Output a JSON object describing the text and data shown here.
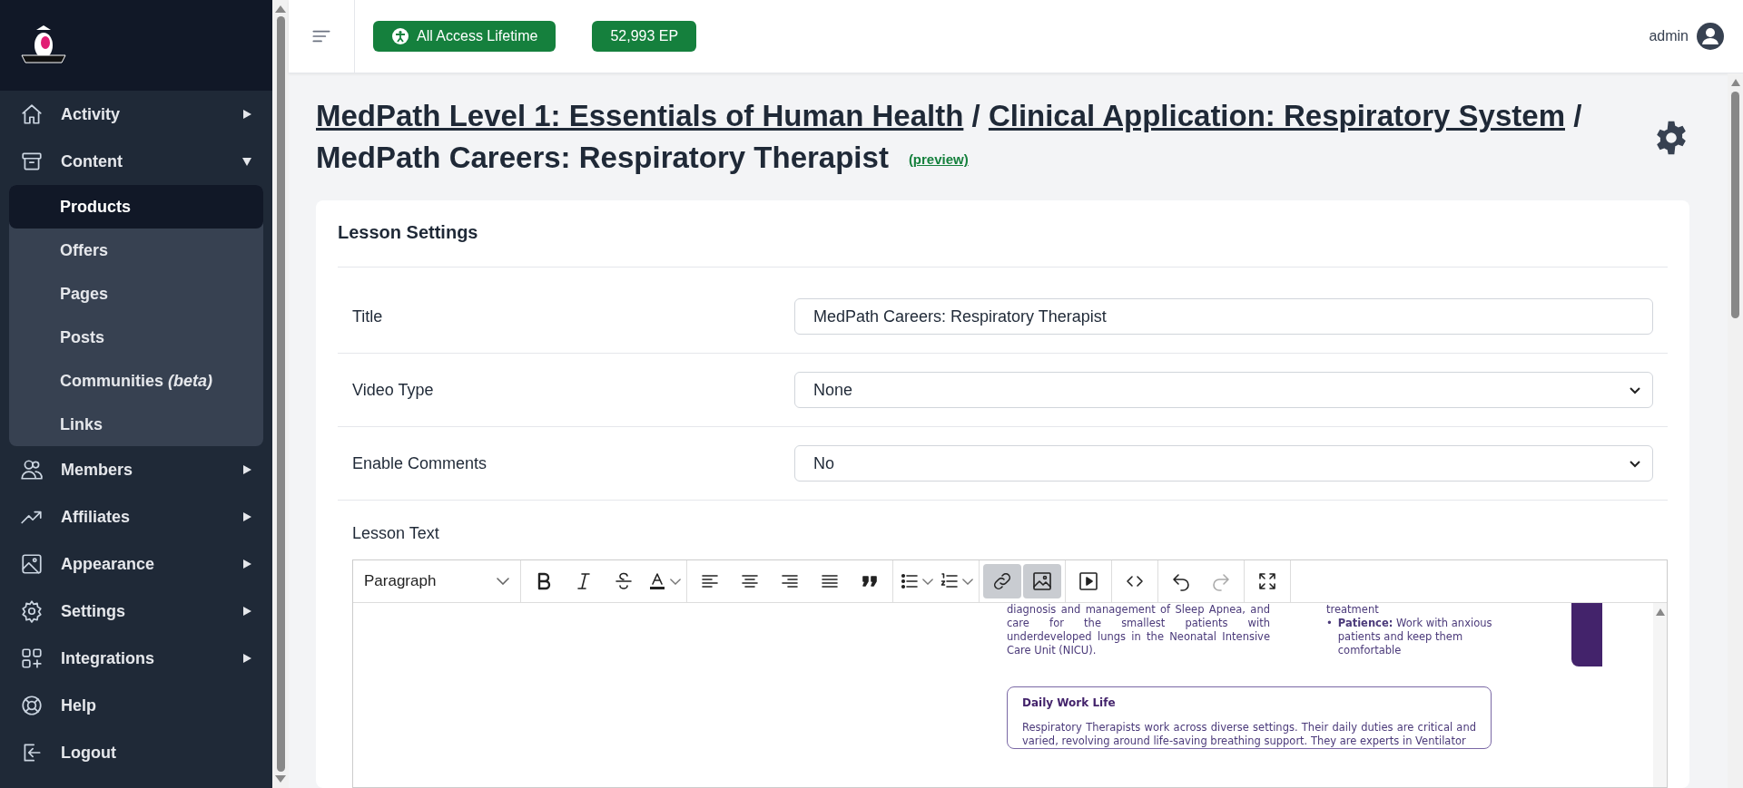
{
  "sidebar": {
    "items": [
      {
        "label": "Activity",
        "kind": "group",
        "expanded": false
      },
      {
        "label": "Content",
        "kind": "group",
        "expanded": true,
        "children": [
          {
            "label": "Products",
            "selected": true
          },
          {
            "label": "Offers",
            "selected": false
          },
          {
            "label": "Pages",
            "selected": false
          },
          {
            "label": "Posts",
            "selected": false
          },
          {
            "label": "Communities *(beta)*",
            "selected": false
          },
          {
            "label": "Links",
            "selected": false
          }
        ]
      },
      {
        "label": "Members",
        "kind": "group",
        "expanded": false
      },
      {
        "label": "Affiliates",
        "kind": "group",
        "expanded": false
      },
      {
        "label": "Appearance",
        "kind": "group",
        "expanded": false
      },
      {
        "label": "Settings",
        "kind": "group",
        "expanded": false
      },
      {
        "label": "Integrations",
        "kind": "group",
        "expanded": false
      },
      {
        "label": "Help",
        "kind": "link"
      },
      {
        "label": "Logout",
        "kind": "link"
      }
    ]
  },
  "top_bar": {
    "plan_badge": "All Access Lifetime",
    "points_badge": "52,993 EP",
    "user": "admin"
  },
  "header": {
    "breadcrumbs": [
      {
        "label": "MedPath Level 1: Essentials of Human Health",
        "kind": "link"
      },
      {
        "label": "Clinical Application: Respiratory System",
        "kind": "link"
      },
      {
        "label": "MedPath Careers: Respiratory Therapist",
        "kind": "current"
      }
    ],
    "separator": "/",
    "preview_link": "(preview)"
  },
  "lesson_settings": {
    "title": "Lesson Settings",
    "fields": [
      {
        "label": "Title",
        "kind": "text",
        "value": "MedPath Careers: Respiratory Therapist"
      },
      {
        "label": "Video Type",
        "kind": "select",
        "value": "None"
      },
      {
        "label": "Enable Comments",
        "kind": "select",
        "value": "No"
      }
    ],
    "lesson_text_label": "Lesson Text"
  },
  "editor": {
    "format_select": "Paragraph",
    "toolbar_groups": [
      [
        {
          "kind": "button",
          "active": false,
          "disabled": false
        },
        {
          "kind": "button",
          "active": false,
          "disabled": false
        },
        {
          "kind": "button",
          "active": false,
          "disabled": false
        },
        {
          "kind": "split",
          "active": false,
          "disabled": false
        }
      ],
      [
        {
          "kind": "button",
          "active": false,
          "disabled": false
        },
        {
          "kind": "button",
          "active": false,
          "disabled": false
        },
        {
          "kind": "button",
          "active": false,
          "disabled": false
        },
        {
          "kind": "button",
          "active": false,
          "disabled": false
        },
        {
          "kind": "button",
          "active": false,
          "disabled": false
        }
      ],
      [
        {
          "kind": "split",
          "active": false,
          "disabled": false
        },
        {
          "kind": "split",
          "active": false,
          "disabled": false
        }
      ],
      [
        {
          "kind": "button",
          "active": true,
          "disabled": false
        },
        {
          "kind": "button",
          "active": true,
          "disabled": false
        }
      ],
      [
        {
          "kind": "button",
          "active": false,
          "disabled": false
        }
      ],
      [
        {
          "kind": "button",
          "active": false,
          "disabled": false
        }
      ],
      [
        {
          "kind": "button",
          "active": false,
          "disabled": false
        },
        {
          "kind": "button",
          "active": false,
          "disabled": true
        }
      ],
      [
        {
          "kind": "button",
          "active": false,
          "disabled": false
        }
      ]
    ],
    "content": {
      "left_paragraph": "diagnosis and management of Sleep Apnea, and care for the smallest patients with underdeveloped lungs in the Neonatal Intensive Care Unit (NICU).",
      "right_text": "treatment",
      "right_bullets": [
        {
          "marker": "•",
          "text": "**Patience:** Work with anxious patients and keep them comfortable"
        }
      ],
      "card_title": "Daily Work Life",
      "card_text": "Respiratory Therapists work across diverse settings. Their daily duties are critical and varied, revolving around life-saving breathing support. They are experts in Ventilator"
    }
  }
}
